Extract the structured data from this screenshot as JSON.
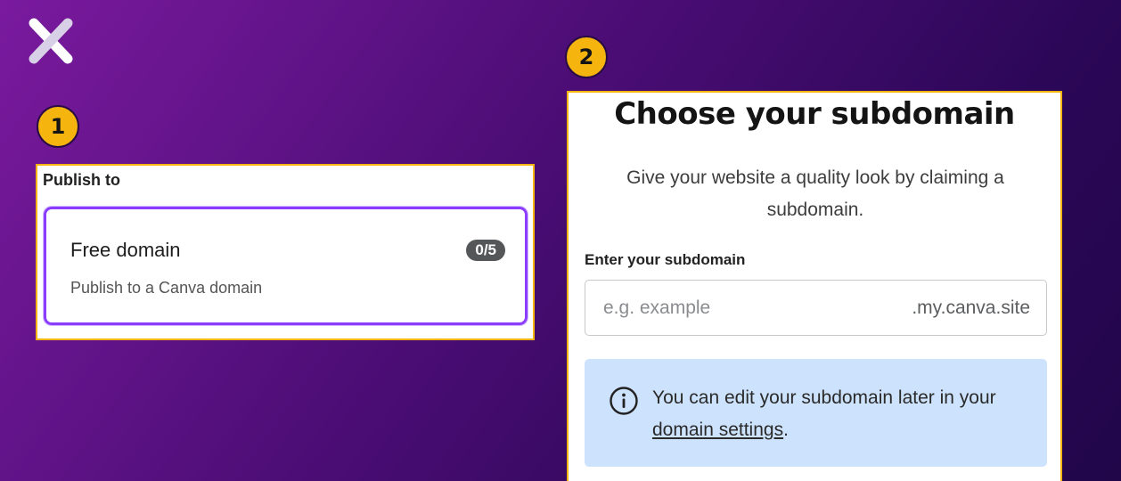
{
  "logo": {
    "icon": "x-logo-icon"
  },
  "steps": [
    {
      "number": "1"
    },
    {
      "number": "2"
    }
  ],
  "publish_panel": {
    "heading": "Publish to",
    "card": {
      "title": "Free domain",
      "subtitle": "Publish to a Canva domain",
      "count": "0/5"
    }
  },
  "subdomain_panel": {
    "title": "Choose your subdomain",
    "description": "Give your website a quality look by claiming a subdomain.",
    "field_label": "Enter your subdomain",
    "input": {
      "value": "",
      "placeholder": "e.g. example",
      "suffix": ".my.canva.site"
    },
    "info": {
      "icon": "info-icon",
      "text_before": "You can edit your subdomain later in your ",
      "link_text": "domain settings",
      "text_after": "."
    }
  },
  "colors": {
    "badge": "#f5b50e",
    "accent": "#8b3dff",
    "info_bg": "#cde2fc",
    "bg_start": "#7a1a9e",
    "bg_end": "#21064a"
  }
}
